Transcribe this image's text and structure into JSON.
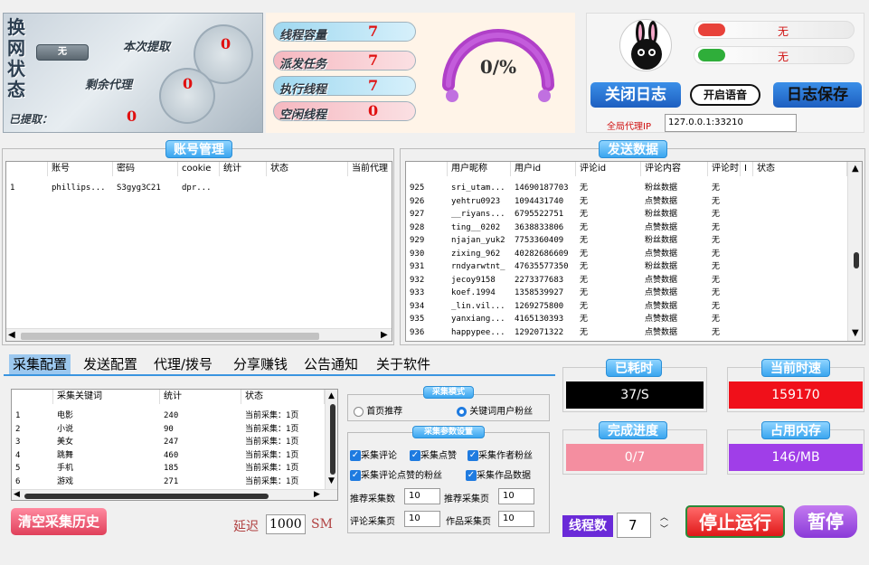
{
  "top_left": {
    "switch_label": "换网状态",
    "switch_value": "无",
    "collected_label": "本次提取",
    "collected_value": "0",
    "remaining_label": "剩余代理",
    "remaining_value": "0",
    "extracted_label": "已提取：",
    "extracted_value": "0"
  },
  "thread_stats": [
    {
      "label": "线程容量",
      "value": "7"
    },
    {
      "label": "派发任务",
      "value": "7"
    },
    {
      "label": "执行线程",
      "value": "7"
    },
    {
      "label": "空闲线程",
      "value": "0"
    }
  ],
  "gauge": {
    "text": "0/%",
    "fraction": 0.0
  },
  "top_right": {
    "status1": "无",
    "status2": "无",
    "btn_close_log": "关闭日志",
    "btn_voice": "开启语音",
    "btn_save_log": "日志保存",
    "proxy_label": "全局代理IP",
    "proxy_value": "127.0.0.1:33210"
  },
  "accounts": {
    "title": "账号管理",
    "columns": [
      "账号",
      "密码",
      "cookie",
      "统计",
      "状态",
      "当前代理"
    ],
    "rows": [
      {
        "idx": "1",
        "account": "phillips...",
        "password": "S3gyg3C21",
        "cookie": "dpr...",
        "stat": "",
        "status": "",
        "proxy": ""
      }
    ]
  },
  "send": {
    "title": "发送数据",
    "columns": [
      "用户昵称",
      "用户id",
      "评论id",
      "评论内容",
      "评论时",
      "I",
      "状态"
    ],
    "rows": [
      {
        "idx": "925",
        "nick": "sri_utam...",
        "uid": "14690187703",
        "cid": "无",
        "content": "粉丝数据",
        "time": "无"
      },
      {
        "idx": "926",
        "nick": "yehtru0923",
        "uid": "1094431740",
        "cid": "无",
        "content": "点赞数据",
        "time": "无"
      },
      {
        "idx": "927",
        "nick": "__riyans...",
        "uid": "6795522751",
        "cid": "无",
        "content": "粉丝数据",
        "time": "无"
      },
      {
        "idx": "928",
        "nick": "ting__0202",
        "uid": "3638833806",
        "cid": "无",
        "content": "点赞数据",
        "time": "无"
      },
      {
        "idx": "929",
        "nick": "njajan_yuk2",
        "uid": "7753360409",
        "cid": "无",
        "content": "粉丝数据",
        "time": "无"
      },
      {
        "idx": "930",
        "nick": "zixing_962",
        "uid": "40282686609",
        "cid": "无",
        "content": "点赞数据",
        "time": "无"
      },
      {
        "idx": "931",
        "nick": "rndyarwtnt_",
        "uid": "47635577350",
        "cid": "无",
        "content": "粉丝数据",
        "time": "无"
      },
      {
        "idx": "932",
        "nick": "jecoy9158",
        "uid": "2273377683",
        "cid": "无",
        "content": "点赞数据",
        "time": "无"
      },
      {
        "idx": "933",
        "nick": "koef.1994",
        "uid": "1358539927",
        "cid": "无",
        "content": "点赞数据",
        "time": "无"
      },
      {
        "idx": "934",
        "nick": "_lin.vil...",
        "uid": "1269275800",
        "cid": "无",
        "content": "点赞数据",
        "time": "无"
      },
      {
        "idx": "935",
        "nick": "yanxiang...",
        "uid": "4165130393",
        "cid": "无",
        "content": "点赞数据",
        "time": "无"
      },
      {
        "idx": "936",
        "nick": "happypee...",
        "uid": "1292071322",
        "cid": "无",
        "content": "点赞数据",
        "time": "无"
      }
    ]
  },
  "tabs": [
    "采集配置",
    "发送配置",
    "代理/拨号",
    "分享赚钱",
    "公告通知",
    "关于软件"
  ],
  "keywords": {
    "columns": [
      "采集关键词",
      "统计",
      "状态"
    ],
    "rows": [
      {
        "idx": "1",
        "kw": "电影",
        "stat": "240",
        "status": "当前采集：1页"
      },
      {
        "idx": "2",
        "kw": "小说",
        "stat": "90",
        "status": "当前采集：1页"
      },
      {
        "idx": "3",
        "kw": "美女",
        "stat": "247",
        "status": "当前采集：1页"
      },
      {
        "idx": "4",
        "kw": "跳舞",
        "stat": "460",
        "status": "当前采集：1页"
      },
      {
        "idx": "5",
        "kw": "手机",
        "stat": "185",
        "status": "当前采集：1页"
      },
      {
        "idx": "6",
        "kw": "游戏",
        "stat": "271",
        "status": "当前采集：1页"
      }
    ]
  },
  "collect": {
    "mode_title": "采集模式",
    "mode_opt1": "首页推荐",
    "mode_opt2": "关键词用户粉丝",
    "params_title": "采集参数设置",
    "chk1": "采集评论",
    "chk2": "采集点赞",
    "chk3": "采集作者粉丝",
    "chk4": "采集评论点赞的粉丝",
    "chk5": "采集作品数据",
    "rec_count_label": "推荐采集数",
    "rec_count": "10",
    "rec_page_label": "推荐采集页",
    "rec_page": "10",
    "cmt_page_label": "评论采集页",
    "cmt_page": "10",
    "work_page_label": "作品采集页",
    "work_page": "10"
  },
  "clear_history": "清空采集历史",
  "delay_label": "延迟",
  "delay_value": "1000",
  "delay_unit": "SM",
  "metrics": {
    "elapsed_label": "已耗时",
    "elapsed_value": "37/S",
    "speed_label": "当前时速",
    "speed_value": "159170",
    "progress_label": "完成进度",
    "progress_value": "0/7",
    "mem_label": "占用内存",
    "mem_value": "146/MB"
  },
  "threads_label": "线程数",
  "threads_value": "7",
  "btn_stop": "停止运行",
  "btn_pause": "暂停"
}
